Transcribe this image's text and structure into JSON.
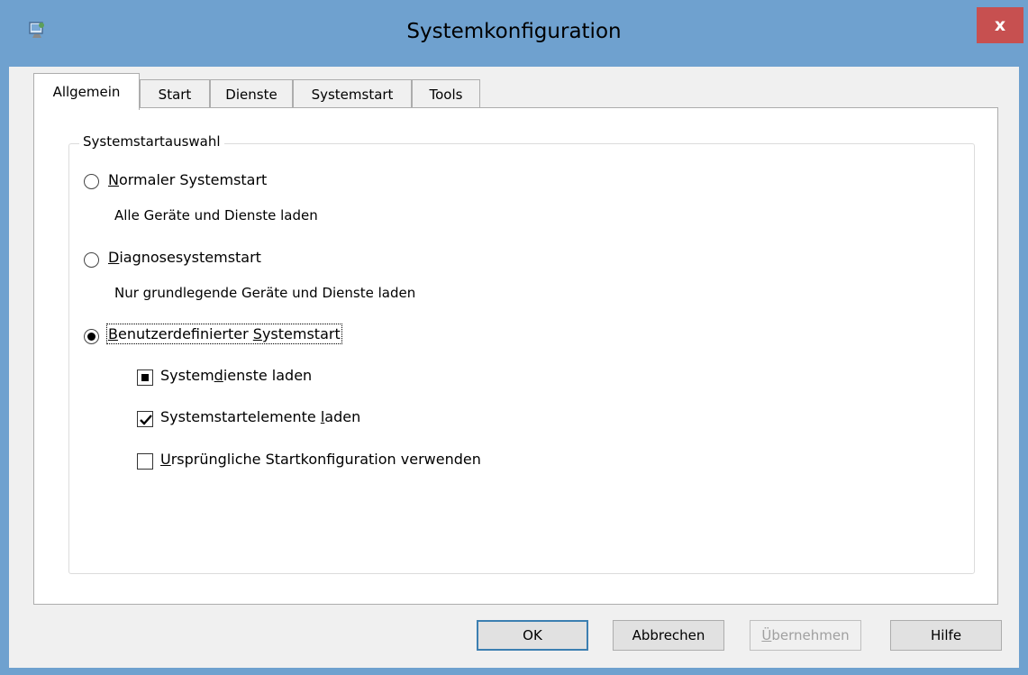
{
  "window": {
    "title": "Systemkonfiguration",
    "close_label": "x",
    "accent_color": "#6fa1cf",
    "close_color": "#c75050"
  },
  "tabs": [
    {
      "label": "Allgemein",
      "active": true
    },
    {
      "label": "Start",
      "active": false
    },
    {
      "label": "Dienste",
      "active": false
    },
    {
      "label": "Systemstart",
      "active": false
    },
    {
      "label": "Tools",
      "active": false
    }
  ],
  "group": {
    "legend": "Systemstartauswahl",
    "options": [
      {
        "pre": "",
        "key": "N",
        "post": "ormaler Systemstart",
        "description": "Alle Geräte und Dienste laden",
        "selected": false
      },
      {
        "pre": "",
        "key": "D",
        "post": "iagnosesystemstart",
        "description": "Nur grundlegende Geräte und Dienste laden",
        "selected": false
      },
      {
        "pre": "",
        "key": "B",
        "post": "enutzerdefinierter ",
        "key2": "S",
        "post2": "ystemstart",
        "selected": true
      }
    ],
    "checks": [
      {
        "pre": "System",
        "key": "d",
        "post": "ienste laden",
        "state": "indeterminate"
      },
      {
        "pre": "Systemstartelemente ",
        "key": "l",
        "post": "aden",
        "state": "checked"
      },
      {
        "pre": "",
        "key": "U",
        "post": "rsprüngliche Startkonfiguration verwenden",
        "state": "unchecked"
      }
    ]
  },
  "buttons": {
    "ok": "OK",
    "cancel": "Abbrechen",
    "apply_key": "Ü",
    "apply_rest": "bernehmen",
    "help": "Hilfe"
  }
}
